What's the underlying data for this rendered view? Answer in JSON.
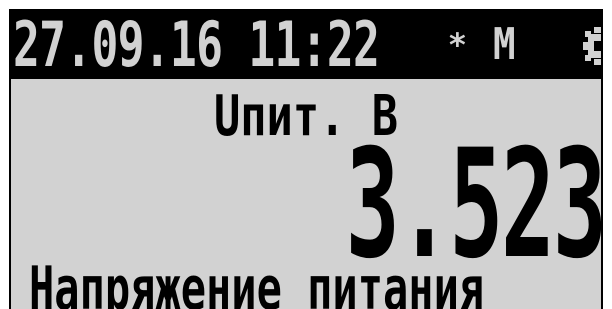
{
  "status_bar": {
    "datetime": "27.09.16 11:22",
    "indicator_star": "*",
    "mode": "M",
    "settings_icon": "gear-icon"
  },
  "parameter": {
    "name": "Uпит. В",
    "value": "3.523",
    "description": "Напряжение питания"
  },
  "colors": {
    "lcd_background": "#d2d2d2",
    "pixel_on": "#000000"
  }
}
